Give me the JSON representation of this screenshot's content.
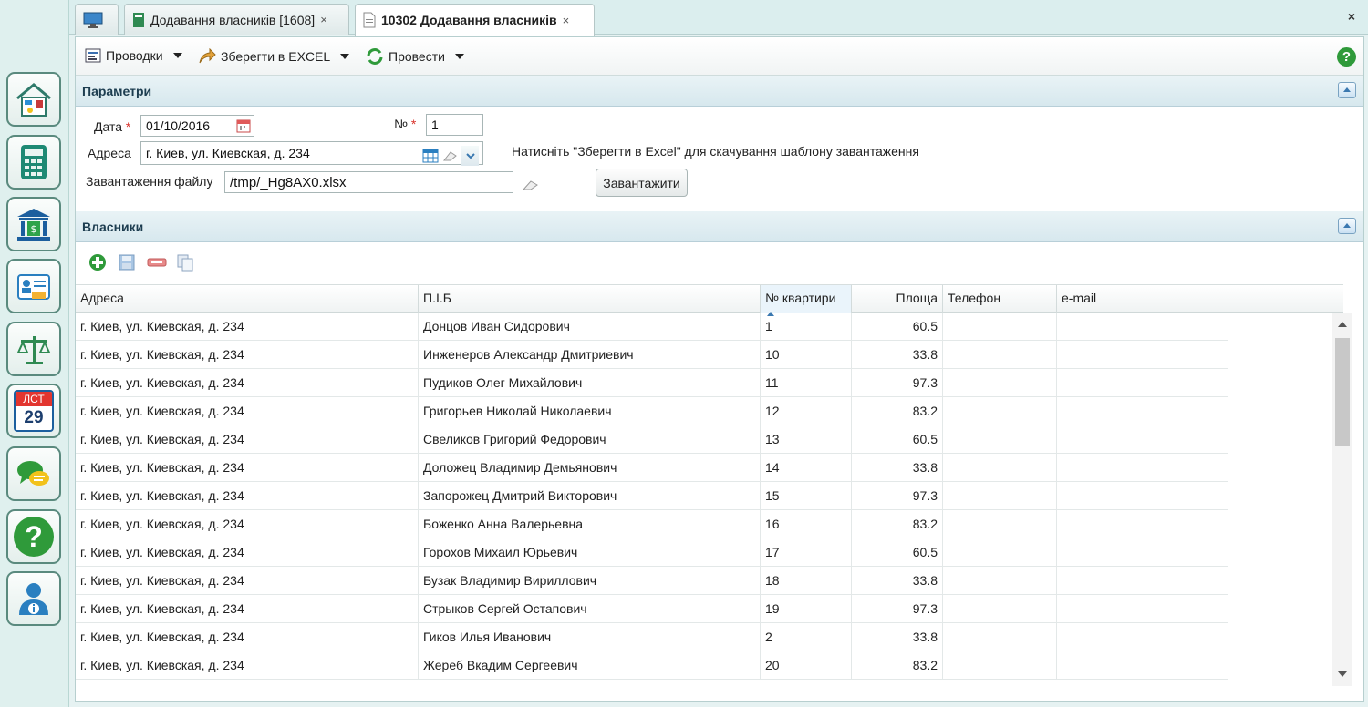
{
  "tabs": [
    {
      "label": ""
    },
    {
      "label": "Додавання власників [1608]",
      "close": "×"
    },
    {
      "label": "10302 Додавання власників",
      "close": "×"
    }
  ],
  "close_all": "×",
  "toolbar": {
    "postings": "Проводки",
    "save_excel": "Зберегти в EXCEL",
    "post": "Провести",
    "help": "?"
  },
  "params": {
    "title": "Параметри",
    "date_label": "Дата",
    "date_value": "01/10/2016",
    "number_label": "№",
    "number_value": "1",
    "required_mark": "*",
    "address_label": "Адреса",
    "address_value": "г. Киев, ул. Киевская, д. 234",
    "hint": "Натисніть \"Зберегти в Excel\" для скачування шаблону завантаження",
    "file_label": "Завантаження файлу",
    "file_value": "/tmp/_Hg8AX0.xlsx",
    "load_button": "Завантажити"
  },
  "owners": {
    "title": "Власники",
    "columns": [
      "Адреса",
      "П.І.Б",
      "№ квартири",
      "Площа",
      "Телефон",
      "e-mail"
    ],
    "rows": [
      {
        "address": "г. Киев, ул. Киевская, д. 234",
        "name": "Донцов Иван Сидорович",
        "flat": "1",
        "area": "60.5",
        "phone": "",
        "email": ""
      },
      {
        "address": "г. Киев, ул. Киевская, д. 234",
        "name": "Инженеров Александр Дмитриевич",
        "flat": "10",
        "area": "33.8",
        "phone": "",
        "email": ""
      },
      {
        "address": "г. Киев, ул. Киевская, д. 234",
        "name": "Пудиков Олег Михайлович",
        "flat": "11",
        "area": "97.3",
        "phone": "",
        "email": ""
      },
      {
        "address": "г. Киев, ул. Киевская, д. 234",
        "name": "Григорьев Николай Николаевич",
        "flat": "12",
        "area": "83.2",
        "phone": "",
        "email": ""
      },
      {
        "address": "г. Киев, ул. Киевская, д. 234",
        "name": "Свеликов Григорий Федорович",
        "flat": "13",
        "area": "60.5",
        "phone": "",
        "email": ""
      },
      {
        "address": "г. Киев, ул. Киевская, д. 234",
        "name": "Доложец Владимир Демьянович",
        "flat": "14",
        "area": "33.8",
        "phone": "",
        "email": ""
      },
      {
        "address": "г. Киев, ул. Киевская, д. 234",
        "name": "Запорожец Дмитрий Викторович",
        "flat": "15",
        "area": "97.3",
        "phone": "",
        "email": ""
      },
      {
        "address": "г. Киев, ул. Киевская, д. 234",
        "name": "Боженко Анна Валерьевна",
        "flat": "16",
        "area": "83.2",
        "phone": "",
        "email": ""
      },
      {
        "address": "г. Киев, ул. Киевская, д. 234",
        "name": "Горохов Михаил Юрьевич",
        "flat": "17",
        "area": "60.5",
        "phone": "",
        "email": ""
      },
      {
        "address": "г. Киев, ул. Киевская, д. 234",
        "name": "Бузак Владимир Вириллович",
        "flat": "18",
        "area": "33.8",
        "phone": "",
        "email": ""
      },
      {
        "address": "г. Киев, ул. Киевская, д. 234",
        "name": "Стрыков Сергей Остапович",
        "flat": "19",
        "area": "97.3",
        "phone": "",
        "email": ""
      },
      {
        "address": "г. Киев, ул. Киевская, д. 234",
        "name": "Гиков Илья Иванович",
        "flat": "2",
        "area": "33.8",
        "phone": "",
        "email": ""
      },
      {
        "address": "г. Киев, ул. Киевская, д. 234",
        "name": "Жереб Вкадим Сергеевич",
        "flat": "20",
        "area": "83.2",
        "phone": "",
        "email": ""
      }
    ]
  },
  "sidebar": {
    "calendar_month": "ЛСТ",
    "calendar_day": "29",
    "items": [
      "home-utilities",
      "calculator",
      "bank",
      "id-card",
      "scales",
      "calendar",
      "chat",
      "help",
      "user-info"
    ]
  },
  "colors": {
    "accent": "#2f9a3a",
    "header_text": "#1d3d50",
    "required": "#d9322b"
  }
}
